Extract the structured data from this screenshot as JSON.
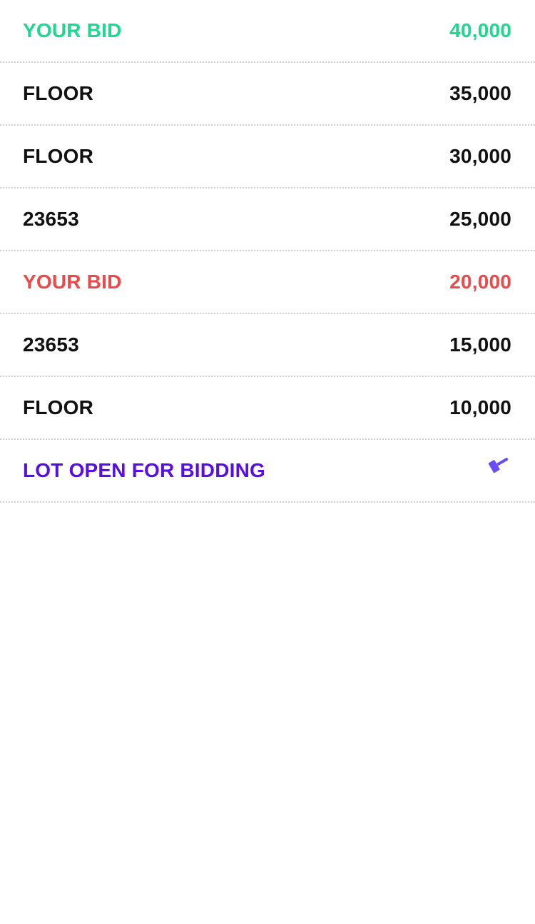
{
  "bids": [
    {
      "label": "YOUR BID",
      "amount": "40,000",
      "type": "yours-winning"
    },
    {
      "label": "FLOOR",
      "amount": "35,000",
      "type": "other"
    },
    {
      "label": "FLOOR",
      "amount": "30,000",
      "type": "other"
    },
    {
      "label": "23653",
      "amount": "25,000",
      "type": "other"
    },
    {
      "label": "YOUR BID",
      "amount": "20,000",
      "type": "yours-outbid"
    },
    {
      "label": "23653",
      "amount": "15,000",
      "type": "other"
    },
    {
      "label": "FLOOR",
      "amount": "10,000",
      "type": "other"
    }
  ],
  "status": {
    "label": "LOT OPEN FOR BIDDING",
    "icon": "gavel-icon"
  },
  "colors": {
    "your_bid_winning": "#1dd98f",
    "your_bid_outbid": "#ec4a4a",
    "status_accent": "#5a0ee6",
    "gavel_icon": "#6a4cf5",
    "default_text": "#111111",
    "divider": "#cfcfcf"
  }
}
